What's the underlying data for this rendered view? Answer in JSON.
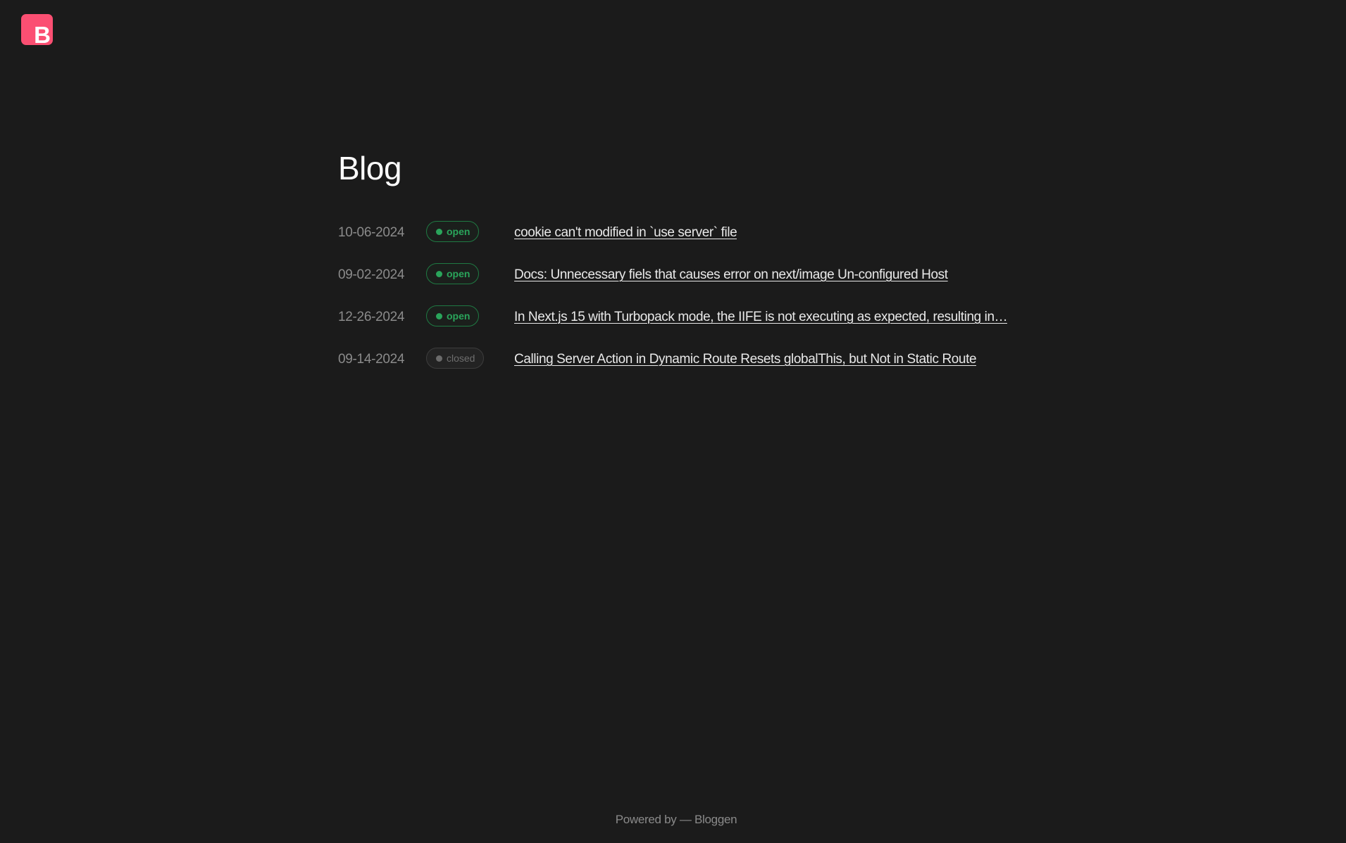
{
  "header": {
    "logo_letter": "B"
  },
  "page": {
    "title": "Blog"
  },
  "posts": [
    {
      "date": "10-06-2024",
      "status": "open",
      "title": "cookie can't modified in `use server` file"
    },
    {
      "date": "09-02-2024",
      "status": "open",
      "title": "Docs: Unnecessary fiels that causes error on next/image Un-configured Host"
    },
    {
      "date": "12-26-2024",
      "status": "open",
      "title": "In Next.js 15 with Turbopack mode, the IIFE is not executing as expected, resulting in…"
    },
    {
      "date": "09-14-2024",
      "status": "closed",
      "title": "Calling Server Action in Dynamic Route Resets globalThis, but Not in Static Route"
    }
  ],
  "footer": {
    "text": "Powered by — Bloggen"
  },
  "colors": {
    "background": "#1b1b1b",
    "logo": "#fb4f72",
    "open": "#2aa55b",
    "closed": "#6e6e6e"
  }
}
